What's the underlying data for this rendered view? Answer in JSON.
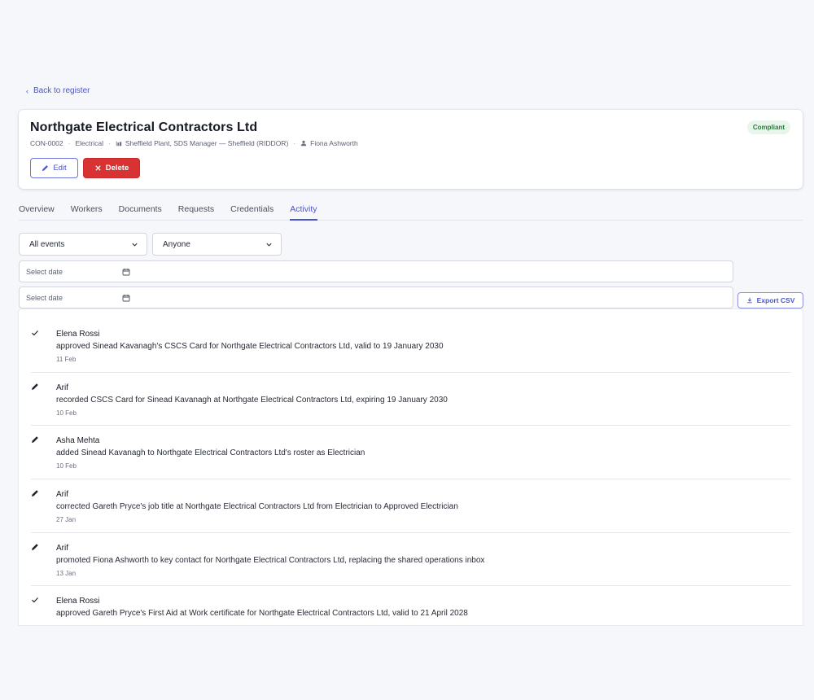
{
  "back_link": {
    "label": "Back to register"
  },
  "company": {
    "name": "Northgate Electrical Contractors Ltd",
    "status": "Compliant",
    "id": "CON-0002",
    "trade": "Electrical",
    "location": "Sheffield Plant, SDS Manager — Sheffield (RIDDOR)",
    "contact": "Fiona Ashworth"
  },
  "actions": {
    "edit_label": "Edit",
    "delete_label": "Delete"
  },
  "tabs": [
    {
      "label": "Overview"
    },
    {
      "label": "Workers"
    },
    {
      "label": "Documents"
    },
    {
      "label": "Requests"
    },
    {
      "label": "Credentials"
    },
    {
      "label": "Activity",
      "active": true
    }
  ],
  "filters": {
    "event_type": "All events",
    "person": "Anyone",
    "from_date_placeholder": "Select date",
    "to_date_placeholder": "Select date",
    "export_label": "Export CSV"
  },
  "colors": {
    "accent": "#4b55c8",
    "danger": "#d93232",
    "success_bg": "#e8f5ea",
    "success_text": "#2d7a3e"
  },
  "activity": [
    {
      "icon": "check-icon",
      "actor": "Elena Rossi",
      "text": "approved Sinead Kavanagh's CSCS Card for Northgate Electrical Contractors Ltd, valid to 19 January 2030",
      "date": "11 Feb"
    },
    {
      "icon": "pencil-icon",
      "actor": "Arif",
      "text": "recorded CSCS Card for Sinead Kavanagh at Northgate Electrical Contractors Ltd, expiring 19 January 2030",
      "date": "10 Feb"
    },
    {
      "icon": "pencil-icon",
      "actor": "Asha Mehta",
      "text": "added Sinead Kavanagh to Northgate Electrical Contractors Ltd's roster as Electrician",
      "date": "10 Feb"
    },
    {
      "icon": "pencil-icon",
      "actor": "Arif",
      "text": "corrected Gareth Pryce's job title at Northgate Electrical Contractors Ltd from Electrician to Approved Electrician",
      "date": "27 Jan"
    },
    {
      "icon": "pencil-icon",
      "actor": "Arif",
      "text": "promoted Fiona Ashworth to key contact for Northgate Electrical Contractors Ltd, replacing the shared operations inbox",
      "date": "13 Jan"
    },
    {
      "icon": "check-icon",
      "actor": "Elena Rossi",
      "text": "approved Gareth Pryce's First Aid at Work certificate for Northgate Electrical Contractors Ltd, valid to 21 April 2028",
      "date": ""
    }
  ]
}
